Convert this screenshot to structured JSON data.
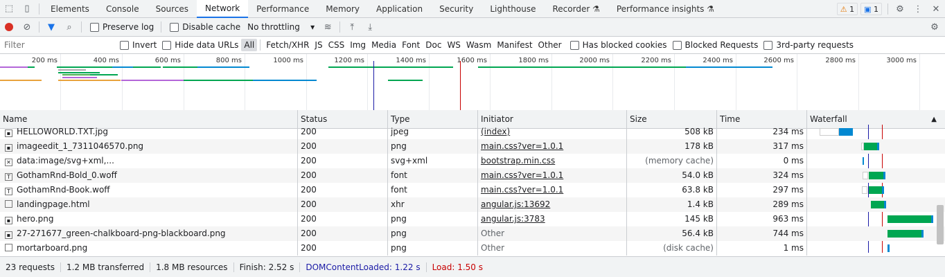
{
  "tabs": [
    "Elements",
    "Console",
    "Sources",
    "Network",
    "Performance",
    "Memory",
    "Application",
    "Security",
    "Lighthouse",
    "Recorder ⚗",
    "Performance insights ⚗"
  ],
  "active_tab": "Network",
  "badges": {
    "warnings": "1",
    "messages": "1"
  },
  "toolbar": {
    "preserve_log": "Preserve log",
    "disable_cache": "Disable cache",
    "throttling": "No throttling"
  },
  "filter": {
    "placeholder": "Filter",
    "invert": "Invert",
    "hide_data_urls": "Hide data URLs",
    "types": [
      "All",
      "Fetch/XHR",
      "JS",
      "CSS",
      "Img",
      "Media",
      "Font",
      "Doc",
      "WS",
      "Wasm",
      "Manifest",
      "Other"
    ],
    "selected_type": "All",
    "has_blocked_cookies": "Has blocked cookies",
    "blocked_requests": "Blocked Requests",
    "third_party": "3rd-party requests"
  },
  "overview_ticks": [
    "200 ms",
    "400 ms",
    "600 ms",
    "800 ms",
    "1000 ms",
    "1200 ms",
    "1400 ms",
    "1600 ms",
    "1800 ms",
    "2000 ms",
    "2200 ms",
    "2400 ms",
    "2600 ms",
    "2800 ms",
    "3000 ms"
  ],
  "columns": [
    "Name",
    "Status",
    "Type",
    "Initiator",
    "Size",
    "Time",
    "Waterfall"
  ],
  "rows": [
    {
      "name": "HELLOWORLD.TXT.jpg",
      "status": "200",
      "type": "jpeg",
      "initiator": "(index)",
      "init_link": true,
      "size": "508 kB",
      "time": "234 ms",
      "icon": "img"
    },
    {
      "name": "imageedit_1_7311046570.png",
      "status": "200",
      "type": "png",
      "initiator": "main.css?ver=1.0.1",
      "init_link": true,
      "size": "178 kB",
      "time": "317 ms",
      "icon": "img"
    },
    {
      "name": "data:image/svg+xml,...",
      "status": "200",
      "type": "svg+xml",
      "initiator": "bootstrap.min.css",
      "init_link": true,
      "size": "(memory cache)",
      "time": "0 ms",
      "icon": "x"
    },
    {
      "name": "GothamRnd-Bold_0.woff",
      "status": "200",
      "type": "font",
      "initiator": "main.css?ver=1.0.1",
      "init_link": true,
      "size": "54.0 kB",
      "time": "324 ms",
      "icon": "font"
    },
    {
      "name": "GothamRnd-Book.woff",
      "status": "200",
      "type": "font",
      "initiator": "main.css?ver=1.0.1",
      "init_link": true,
      "size": "63.8 kB",
      "time": "297 ms",
      "icon": "font"
    },
    {
      "name": "landingpage.html",
      "status": "200",
      "type": "xhr",
      "initiator": "angular.js:13692",
      "init_link": true,
      "size": "1.4 kB",
      "time": "289 ms",
      "icon": "doc"
    },
    {
      "name": "hero.png",
      "status": "200",
      "type": "png",
      "initiator": "angular.js:3783",
      "init_link": true,
      "size": "145 kB",
      "time": "963 ms",
      "icon": "img"
    },
    {
      "name": "27-271677_green-chalkboard-png-blackboard.png",
      "status": "200",
      "type": "png",
      "initiator": "Other",
      "init_link": false,
      "size": "56.4 kB",
      "time": "744 ms",
      "icon": "img"
    },
    {
      "name": "mortarboard.png",
      "status": "200",
      "type": "png",
      "initiator": "Other",
      "init_link": false,
      "size": "(disk cache)",
      "time": "1 ms",
      "icon": "doc"
    }
  ],
  "status_bar": {
    "requests": "23 requests",
    "transferred": "1.2 MB transferred",
    "resources": "1.8 MB resources",
    "finish": "Finish: 2.52 s",
    "dcl": "DOMContentLoaded: 1.22 s",
    "load": "Load: 1.50 s"
  },
  "colors": {
    "accent": "#1a73e8",
    "dcl": "#1a1aa6",
    "load": "#c80000",
    "waiting": "#00a651",
    "download": "#0288d1"
  }
}
